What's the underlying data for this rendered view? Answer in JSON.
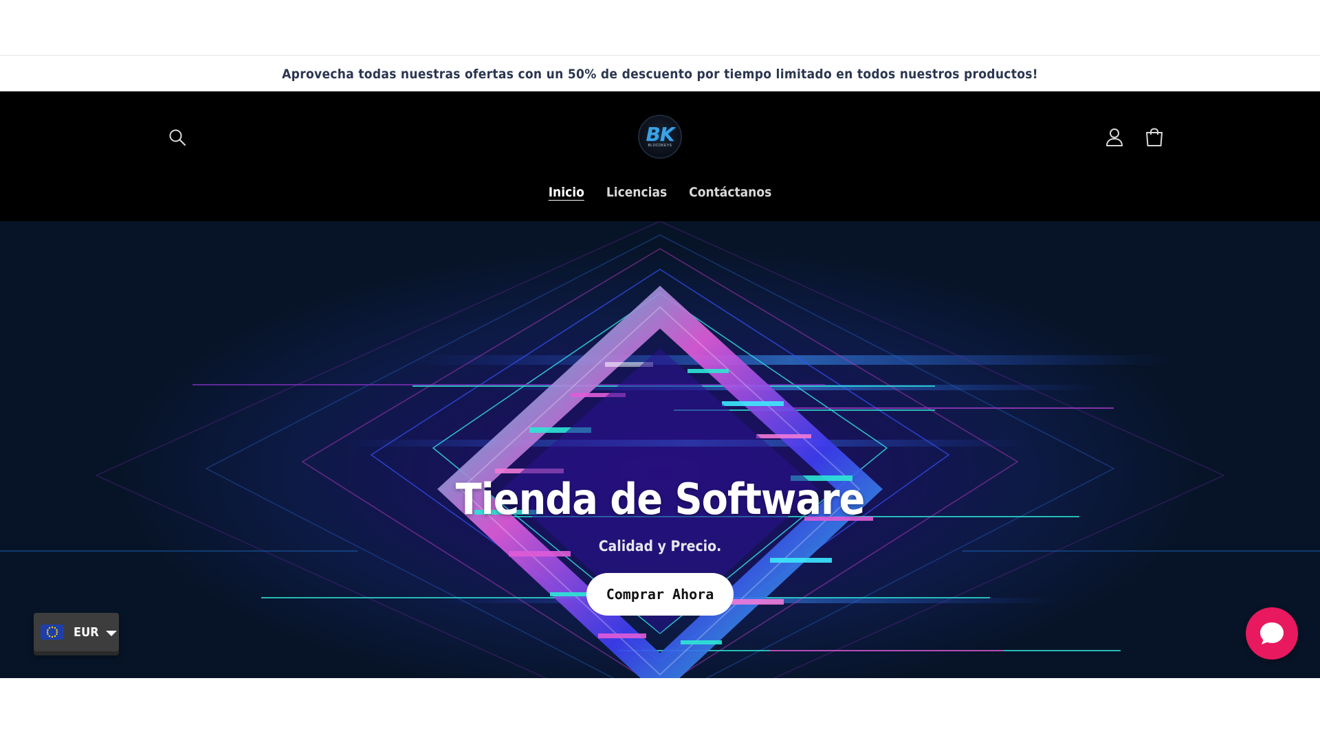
{
  "announcement": {
    "text": "Aprovecha todas nuestras ofertas con un 50% de descuento por tiempo limitado en todos nuestros productos!"
  },
  "header": {
    "logo_text": "BK",
    "logo_subtext": "BLOCDKEYS",
    "icons": {
      "search": "search-icon",
      "account": "user-icon",
      "cart": "shopping-bag-icon"
    }
  },
  "nav": {
    "items": [
      {
        "label": "Inicio",
        "active": true
      },
      {
        "label": "Licencias",
        "active": false
      },
      {
        "label": "Contáctanos",
        "active": false
      }
    ]
  },
  "hero": {
    "title": "Tienda de Software",
    "subtitle": "Calidad y Precio.",
    "cta_label": "Comprar Ahora"
  },
  "currency": {
    "code": "EUR",
    "flag": "eu-flag-icon"
  },
  "chat": {
    "icon": "chat-bubble-icon",
    "color": "#e8195e"
  },
  "colors": {
    "announcement_text": "#2b3650",
    "header_bg": "#000000",
    "hero_bg": "#0d1a45",
    "accent_cyan": "#2ee6d6",
    "accent_pink": "#e05cd8",
    "accent_blue": "#3d3df0"
  }
}
